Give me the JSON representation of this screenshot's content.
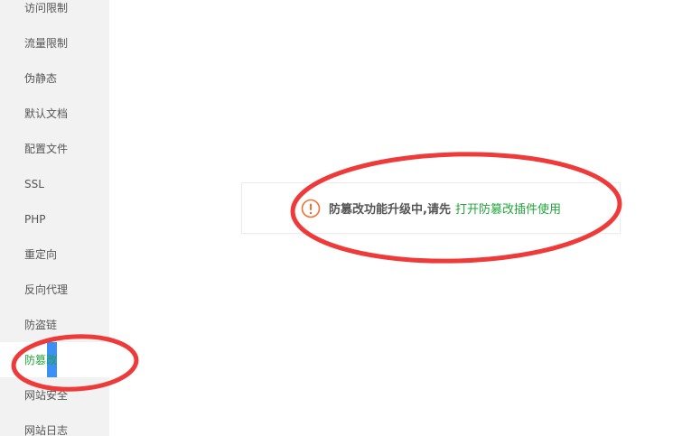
{
  "sidebar": {
    "items": [
      {
        "label": "访问限制"
      },
      {
        "label": "流量限制"
      },
      {
        "label": "伪静态"
      },
      {
        "label": "默认文档"
      },
      {
        "label": "配置文件"
      },
      {
        "label": "SSL"
      },
      {
        "label": "PHP"
      },
      {
        "label": "重定向"
      },
      {
        "label": "反向代理"
      },
      {
        "label": "防盗链"
      },
      {
        "label": "防篡改"
      },
      {
        "label": "网站安全"
      },
      {
        "label": "网站日志"
      }
    ],
    "active_index": 10
  },
  "notice": {
    "icon": "exclamation-circle-icon",
    "message": "防篡改功能升级中,请先",
    "link_label": "打开防篡改插件使用"
  },
  "colors": {
    "sidebar_bg": "#f2f2f2",
    "active_text": "#20a53a",
    "link": "#20a53a",
    "warning_icon": "#f0702d",
    "annotation": "#ef3a3a"
  }
}
